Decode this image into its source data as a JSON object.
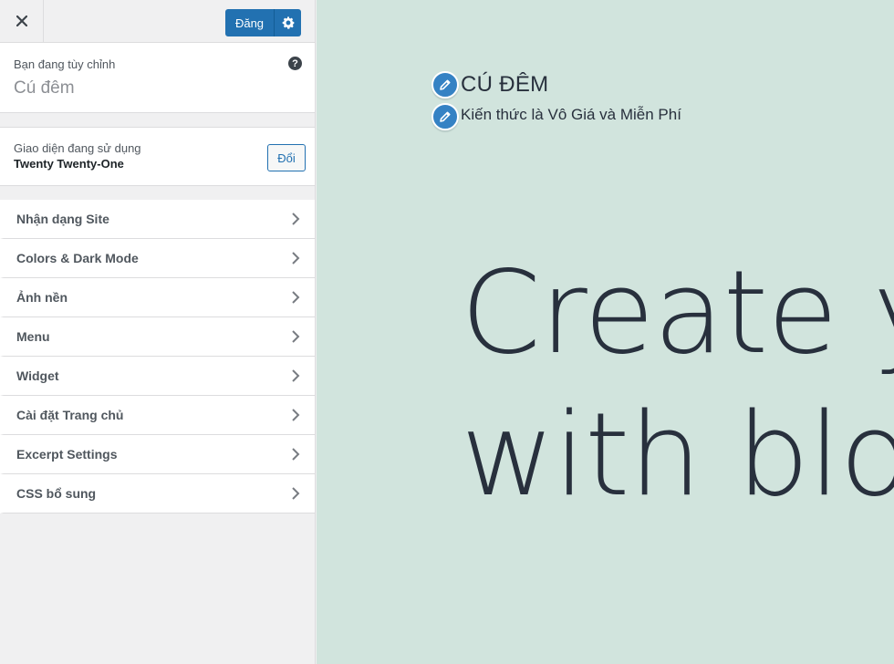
{
  "header": {
    "close_label": "×",
    "publish_label": "Đăng"
  },
  "info": {
    "customizing_label": "Bạn đang tùy chỉnh",
    "site_name": "Cú đêm",
    "help_label": "?"
  },
  "theme": {
    "label": "Giao diện đang sử dụng",
    "name": "Twenty Twenty-One",
    "change_label": "Đổi"
  },
  "menu": {
    "items": [
      {
        "label": "Nhận dạng Site"
      },
      {
        "label": "Colors & Dark Mode"
      },
      {
        "label": "Ảnh nền"
      },
      {
        "label": "Menu"
      },
      {
        "label": "Widget"
      },
      {
        "label": "Cài đặt Trang chủ"
      },
      {
        "label": "Excerpt Settings"
      },
      {
        "label": "CSS bổ sung"
      }
    ]
  },
  "preview": {
    "site_title": "CÚ ĐÊM",
    "tagline": "Kiến thức là Vô Giá và Miễn Phí",
    "hero_line_1": "Create y",
    "hero_line_2": "with blo"
  },
  "colors": {
    "accent": "#2271b1",
    "preview_bg": "#d1e4dd",
    "edit_shortcut": "#3582c4",
    "text_dark": "#28303d"
  },
  "icons": [
    "close-icon",
    "gear-icon",
    "help-icon",
    "chevron-right-icon",
    "pencil-icon"
  ]
}
